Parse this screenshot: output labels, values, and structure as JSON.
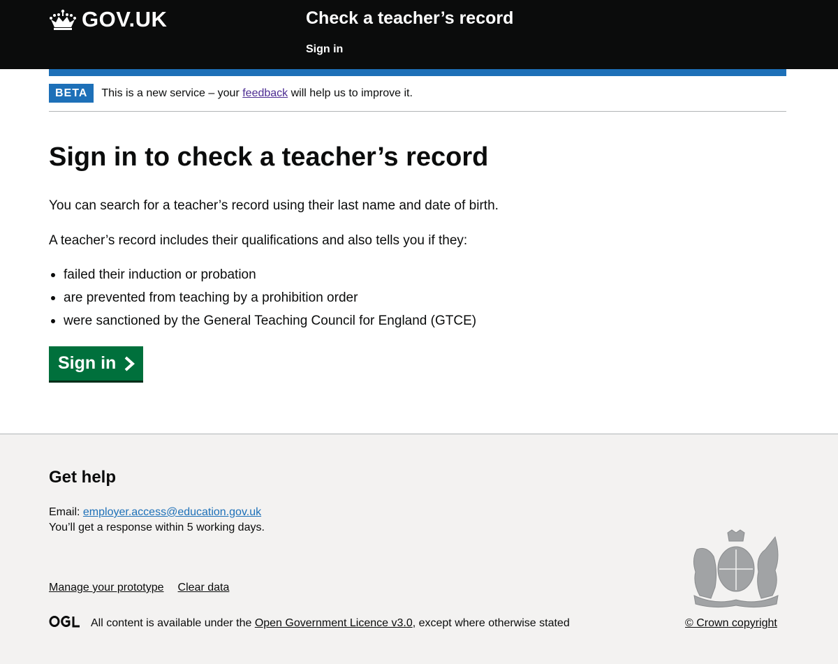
{
  "header": {
    "logo_text": "GOV.UK",
    "service_name": "Check a teacher’s record",
    "nav_signin": "Sign in"
  },
  "phase_banner": {
    "tag": "BETA",
    "text_before": "This is a new service – your ",
    "link": "feedback",
    "text_after": " will help us to improve it."
  },
  "main": {
    "heading": "Sign in to check a teacher’s record",
    "para1": "You can search for a teacher’s record using their last name and date of birth.",
    "para2": "A teacher’s record includes their qualifications and also tells you if they:",
    "bullets": [
      "failed their induction or probation",
      "are prevented from teaching by a prohibition order",
      "were sanctioned by the General Teaching Council for England (GTCE)"
    ],
    "signin_button": "Sign in"
  },
  "footer": {
    "heading": "Get help",
    "email_label": "Email: ",
    "email": "employer.access@education.gov.uk",
    "response_text": "You’ll get a response within 5 working days.",
    "links": [
      "Manage your prototype",
      "Clear data"
    ],
    "licence_before": "All content is available under the ",
    "licence_link": "Open Government Licence v3.0",
    "licence_after": ", except where otherwise stated",
    "copyright": "© Crown copyright"
  },
  "icons": {
    "logo": "crown-icon",
    "button": "chevron-right-icon",
    "licence": "ogl-logo-icon",
    "crest": "royal-coat-of-arms-icon"
  },
  "colors": {
    "header_bg": "#0b0c0c",
    "brand_blue": "#1d70b8",
    "start_button": "#00703c",
    "visited_link": "#4c2c92",
    "footer_bg": "#f3f2f1"
  }
}
